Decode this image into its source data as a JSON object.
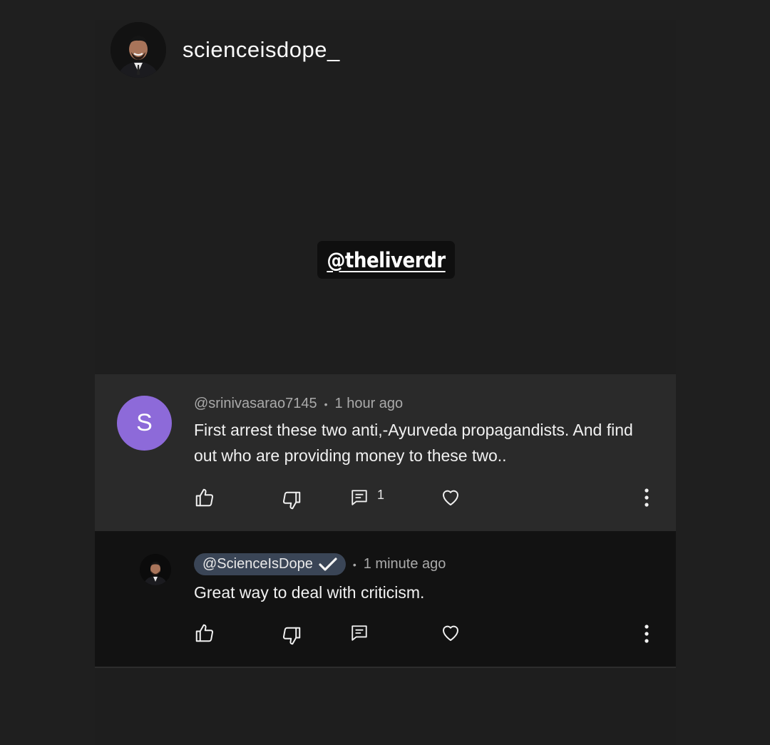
{
  "story": {
    "username": "scienceisdope_",
    "mention": "@theliverdr"
  },
  "comment": {
    "avatar_letter": "S",
    "author": "@srinivasarao7145",
    "separator": "•",
    "time": "1 hour ago",
    "text": "First arrest these two anti,-Ayurveda propagandists. And find out who are providing money to these two..",
    "reply_count": "1"
  },
  "reply": {
    "author": "@ScienceIsDope",
    "separator": "•",
    "time": "1 minute ago",
    "text": "Great way to deal with criticism."
  },
  "colors": {
    "background": "#1f1f1f",
    "comment_bg": "#2a2a2a",
    "reply_bg": "#121212",
    "avatar_purple": "#8d6ad9",
    "verified_chip": "#3a4556"
  },
  "icons": [
    "like-icon",
    "dislike-icon",
    "reply-icon",
    "heart-icon",
    "more-icon",
    "verified-check-icon"
  ]
}
